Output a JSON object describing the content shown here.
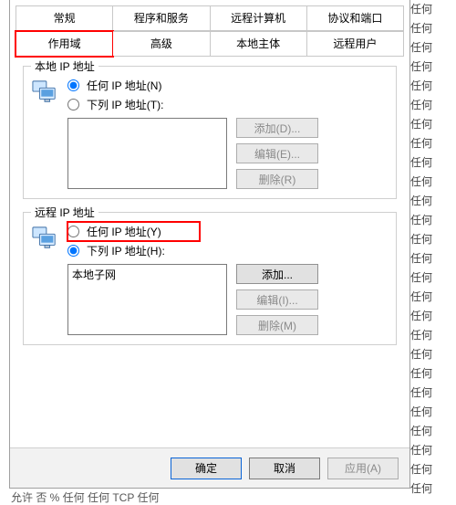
{
  "bg_repeat_text": "任何",
  "tabs": {
    "row1": [
      "常规",
      "程序和服务",
      "远程计算机",
      "协议和端口"
    ],
    "row2": [
      "作用域",
      "高级",
      "本地主体",
      "远程用户"
    ],
    "active": "作用域"
  },
  "local_group": {
    "title": "本地 IP 地址",
    "radio_any": "任何 IP 地址(N)",
    "radio_any_u": "N",
    "radio_list": "下列 IP 地址(T):",
    "radio_list_u": "T",
    "btn_add": "添加(D)...",
    "btn_edit": "编辑(E)...",
    "btn_del": "删除(R)"
  },
  "remote_group": {
    "title": "远程 IP 地址",
    "radio_any": "任何 IP 地址(Y)",
    "radio_any_u": "Y",
    "radio_list": "下列 IP 地址(H):",
    "radio_list_u": "H",
    "list_items": [
      "本地子网"
    ],
    "btn_add": "添加...",
    "btn_edit": "编辑(I)...",
    "btn_del": "删除(M)"
  },
  "footer": {
    "ok": "确定",
    "cancel": "取消",
    "apply": "应用(A)"
  },
  "status_hint": "允许     否       %     任何     任何                TCP     任何"
}
